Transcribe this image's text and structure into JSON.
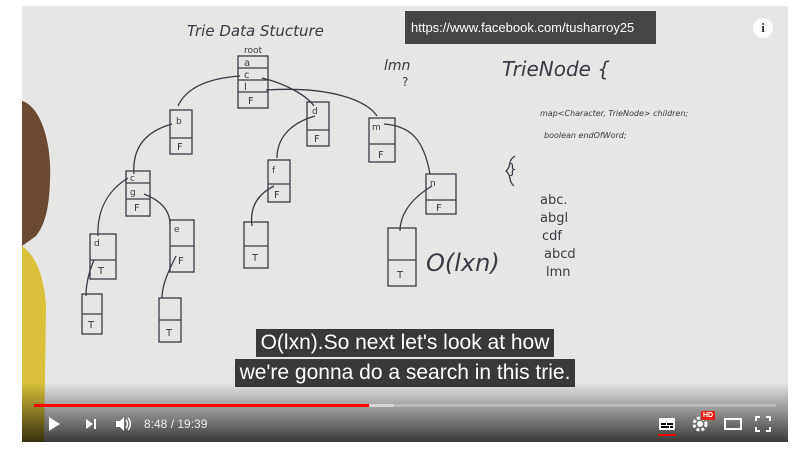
{
  "video": {
    "watermark_url": "https://www.facebook.com/tusharroy25",
    "info_label": "i",
    "captions": [
      "O(lxn).So next let's look at how",
      "we're gonna do a search in this trie."
    ],
    "progress": {
      "played_fraction": 0.451,
      "loaded_fraction": 0.485
    },
    "time": {
      "current": "8:48",
      "separator": " / ",
      "duration": "19:39"
    },
    "hd_badge": "HD",
    "colors": {
      "progress_played": "#ff0000",
      "hd_badge": "#e62117"
    }
  },
  "board": {
    "title": "Trie   Data   Stucture",
    "root_label": "root",
    "root_chars": [
      "a",
      "c",
      "l"
    ],
    "flag_false": "F",
    "flag_true": "T",
    "node_labels": [
      "b",
      "d",
      "m",
      "c",
      "g",
      "f",
      "n",
      "d",
      "e"
    ],
    "query": "lmn",
    "query_mark": "?",
    "class_heading": "TrieNode {",
    "field_children": "map<Character, TrieNode> children;",
    "field_end": "boolean endOfWord;",
    "class_close": "}",
    "words": [
      "abc.",
      "abgl",
      "cdf",
      "abcd",
      "lmn"
    ],
    "complexity": "O(lxn)"
  }
}
